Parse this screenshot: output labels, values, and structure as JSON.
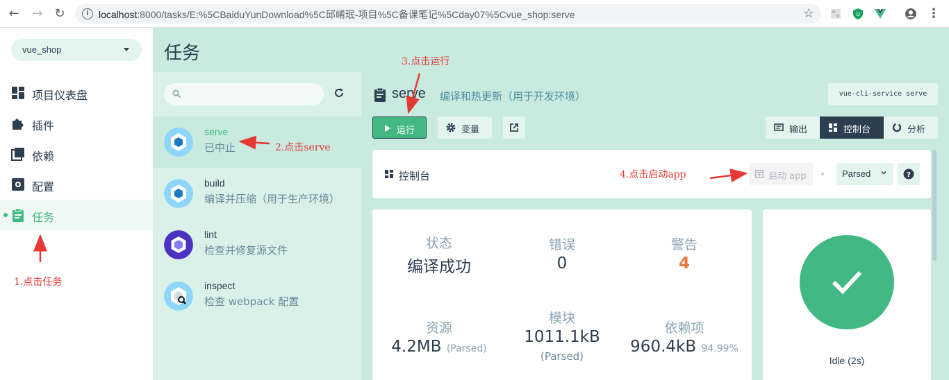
{
  "browser": {
    "url_host": "localhost",
    "url_rest": ":8000/tasks/E:%5CBaiduYunDownload%5C邱崤珉-项目%5C备课笔记%5Cday07%5Cvue_shop:serve"
  },
  "sidebar": {
    "project": "vue_shop",
    "items": [
      {
        "label": "项目仪表盘"
      },
      {
        "label": "插件"
      },
      {
        "label": "依赖"
      },
      {
        "label": "配置"
      },
      {
        "label": "任务"
      }
    ]
  },
  "page": {
    "title": "任务"
  },
  "tasks": [
    {
      "name": "serve",
      "desc": "已中止"
    },
    {
      "name": "build",
      "desc": "编译并压缩（用于生产环境）"
    },
    {
      "name": "lint",
      "desc": "检查并修复源文件"
    },
    {
      "name": "inspect",
      "desc": "检查 webpack 配置"
    }
  ],
  "task_detail": {
    "name": "serve",
    "desc": "编译和热更新（用于开发环境）",
    "command": "vue-cli-service serve",
    "run_label": "运行",
    "vars_label": "变量",
    "tabs": {
      "output": "输出",
      "console": "控制台",
      "analysis": "分析"
    }
  },
  "console": {
    "title": "控制台",
    "start_app": "启动 app",
    "mode": "Parsed"
  },
  "stats": {
    "status": {
      "label": "状态",
      "value": "编译成功"
    },
    "errors": {
      "label": "错误",
      "value": "0"
    },
    "warnings": {
      "label": "警告",
      "value": "4"
    },
    "assets": {
      "label": "资源",
      "value": "4.2MB",
      "unit": "(Parsed)"
    },
    "modules": {
      "label": "模块",
      "value": "1011.1kB",
      "unit": "(Parsed)"
    },
    "deps": {
      "label": "依赖项",
      "value": "960.4kB",
      "unit": "94.99%"
    }
  },
  "status_card": {
    "label": "Idle (2s)"
  },
  "annotations": {
    "a1": "1.点击任务",
    "a2": "2.点击serve",
    "a3": "3.点击运行",
    "a4": "4.点击启动app"
  },
  "colors": {
    "accent": "#42b983",
    "dark": "#2c3e50",
    "warn": "#e8793a",
    "annotation": "#e53935"
  }
}
